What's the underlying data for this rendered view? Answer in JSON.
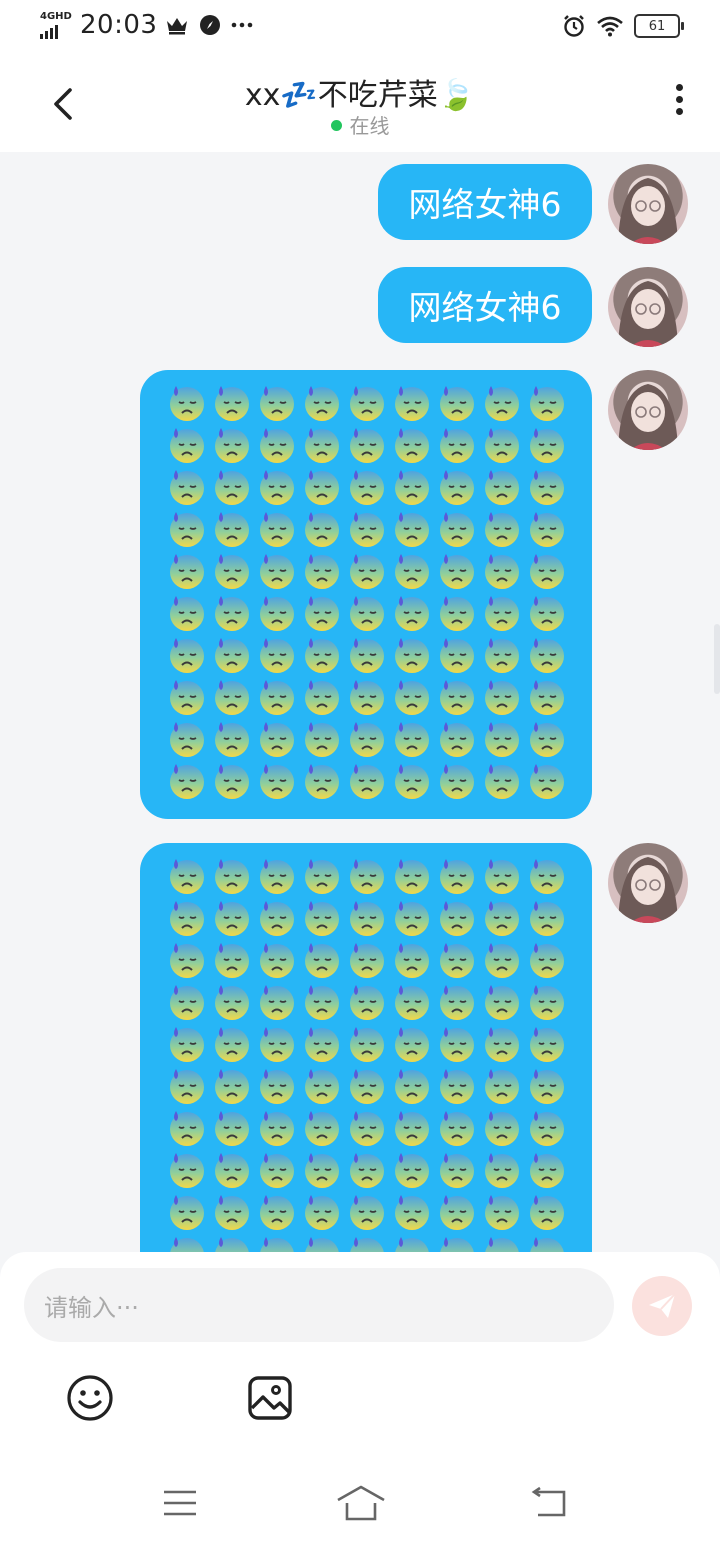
{
  "status_bar": {
    "network_label": "4GHD",
    "time": "20:03",
    "battery": "61"
  },
  "header": {
    "title": "xx💤不吃芹菜🍃",
    "presence": "在线"
  },
  "messages": [
    {
      "type": "text",
      "text": "网络女神6"
    },
    {
      "type": "text",
      "text": "网络女神6"
    },
    {
      "type": "emoji",
      "emoji": "😓",
      "rows": 10,
      "cols": 9
    },
    {
      "type": "emoji",
      "emoji": "😓",
      "rows": 10,
      "cols": 9
    }
  ],
  "composer": {
    "placeholder": "请输入···"
  },
  "colors": {
    "bubble": "#27b6f6",
    "online": "#22c55e",
    "send_bg": "#fbe1de"
  }
}
